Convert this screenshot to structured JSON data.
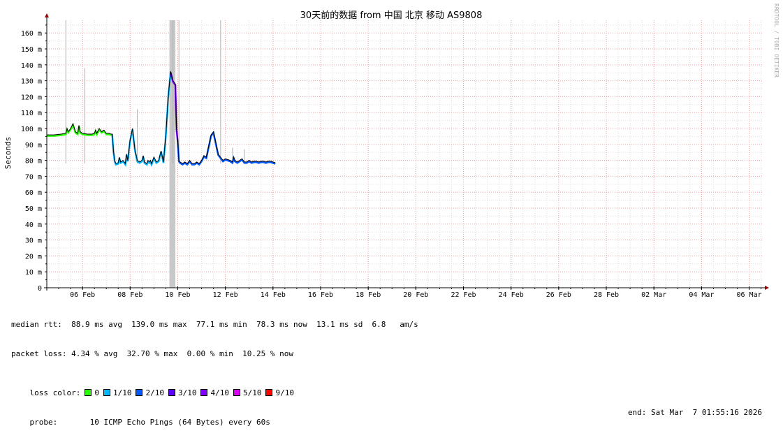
{
  "chart_data": {
    "type": "line",
    "title": "30天前的数据 from 中国 北京 移动 AS9808",
    "ylabel": "Seconds",
    "xlabel": "",
    "watermark": "RRDTOOL / TOBI OETIKER",
    "ylim": [
      0,
      168
    ],
    "y_ticks": [
      0,
      10,
      20,
      30,
      40,
      50,
      60,
      70,
      80,
      90,
      100,
      110,
      120,
      130,
      140,
      150,
      160
    ],
    "y_tick_labels": [
      "0",
      "10 m",
      "20 m",
      "30 m",
      "40 m",
      "50 m",
      "60 m",
      "70 m",
      "80 m",
      "90 m",
      "100 m",
      "110 m",
      "120 m",
      "130 m",
      "140 m",
      "150 m",
      "160 m"
    ],
    "x_unit": "days since start of axis (Feb 4 00:00)",
    "xlim": [
      0,
      30.1
    ],
    "x_ticks": [
      1.5,
      3.5,
      5.5,
      7.5,
      9.5,
      11.5,
      13.5,
      15.5,
      17.5,
      19.5,
      21.5,
      23.5,
      25.5,
      27.5,
      29.5
    ],
    "x_tick_labels": [
      "06 Feb",
      "08 Feb",
      "10 Feb",
      "12 Feb",
      "14 Feb",
      "16 Feb",
      "18 Feb",
      "20 Feb",
      "22 Feb",
      "24 Feb",
      "26 Feb",
      "28 Feb",
      "02 Mar",
      "04 Mar",
      "06 Mar"
    ],
    "series": [
      {
        "name": "median rtt",
        "x": [
          0,
          0.3,
          0.6,
          0.8,
          0.85,
          0.9,
          1.0,
          1.1,
          1.2,
          1.3,
          1.35,
          1.4,
          1.5,
          1.7,
          1.9,
          2.0,
          2.05,
          2.1,
          2.2,
          2.3,
          2.4,
          2.5,
          2.6,
          2.7,
          2.75,
          2.8,
          2.85,
          2.9,
          3.0,
          3.05,
          3.1,
          3.2,
          3.3,
          3.35,
          3.4,
          3.5,
          3.6,
          3.7,
          3.8,
          3.9,
          4.0,
          4.05,
          4.1,
          4.2,
          4.25,
          4.3,
          4.35,
          4.4,
          4.5,
          4.6,
          4.7,
          4.8,
          4.9,
          5.0,
          5.1,
          5.2,
          5.3,
          5.4,
          5.45,
          5.5,
          5.55,
          5.6,
          5.7,
          5.8,
          5.9,
          6.0,
          6.1,
          6.2,
          6.3,
          6.4,
          6.5,
          6.6,
          6.7,
          6.8,
          6.9,
          7.0,
          7.2,
          7.4,
          7.5,
          7.7,
          7.8,
          7.85,
          7.9,
          8.0,
          8.1,
          8.2,
          8.3,
          8.4,
          8.5,
          8.6,
          8.7,
          8.8,
          8.9,
          9.0,
          9.1,
          9.2,
          9.3,
          9.4,
          9.5,
          9.6
        ],
        "values": [
          96,
          96,
          96.5,
          97,
          100,
          98,
          100,
          103,
          98,
          97,
          102,
          98,
          97,
          96.5,
          96.5,
          97,
          99,
          97,
          100,
          98,
          99,
          97,
          97,
          96.5,
          96.5,
          86,
          80,
          78,
          78.5,
          82,
          79,
          80,
          78,
          84,
          80,
          93,
          100,
          87,
          80,
          79,
          80,
          83,
          79,
          78,
          80,
          79,
          80,
          78,
          82,
          79,
          80,
          86,
          79,
          96,
          120,
          136,
          130,
          128,
          100,
          92,
          80,
          79,
          78,
          79,
          78,
          80,
          78,
          78,
          79,
          78,
          80,
          83,
          82,
          89,
          96,
          98,
          84,
          80,
          81,
          80,
          79,
          82,
          80,
          79,
          80,
          81,
          79,
          79,
          80,
          79,
          79.5,
          79.5,
          79,
          79.5,
          79.5,
          79,
          79.5,
          79.5,
          79,
          78.5
        ]
      }
    ],
    "spikes": [
      {
        "x": 0.8,
        "value": 168
      },
      {
        "x": 1.6,
        "value": 138
      },
      {
        "x": 3.8,
        "value": 112
      },
      {
        "x": 5.3,
        "value": 168
      },
      {
        "x": 5.55,
        "value": 168
      },
      {
        "x": 7.3,
        "value": 168
      },
      {
        "x": 7.8,
        "value": 88
      },
      {
        "x": 8.3,
        "value": 87
      }
    ],
    "shaded": [
      {
        "x0": 5.15,
        "x1": 5.4
      }
    ],
    "loss_segments": [
      {
        "x0": 0,
        "x1": 2.7,
        "color": "#26ff00"
      },
      {
        "x0": 2.7,
        "x1": 5.2,
        "color": "#00b8ff"
      },
      {
        "x0": 5.2,
        "x1": 5.5,
        "color": "#7e00ff"
      },
      {
        "x0": 5.5,
        "x1": 9.6,
        "color": "#0059ff"
      }
    ]
  },
  "stats": {
    "median_rtt": "median rtt:  88.9 ms avg  139.0 ms max  77.1 ms min  78.3 ms now  13.1 ms sd  6.8   am/s",
    "packet_loss": "packet loss: 4.34 % avg  32.70 % max  0.00 % min  10.25 % now",
    "loss_color_label": "loss color:",
    "loss_colors": [
      {
        "label": "0",
        "color": "#26ff00"
      },
      {
        "label": "1/10",
        "color": "#00b8ff"
      },
      {
        "label": "2/10",
        "color": "#0059ff"
      },
      {
        "label": "3/10",
        "color": "#5e00ff"
      },
      {
        "label": "4/10",
        "color": "#7e00ff"
      },
      {
        "label": "5/10",
        "color": "#dd00ff"
      },
      {
        "label": "9/10",
        "color": "#ff0000"
      }
    ],
    "probe": "probe:       10 ICMP Echo Pings (64 Bytes) every 60s",
    "end": "end: Sat Mar  7 01:55:16 2026"
  },
  "colors": {
    "grid_minor": "#dddddd",
    "grid_major": "#f0a0a0",
    "axis": "#000000",
    "arrow": "#990000",
    "shade": "#c8c8c8",
    "line": "#000000"
  }
}
